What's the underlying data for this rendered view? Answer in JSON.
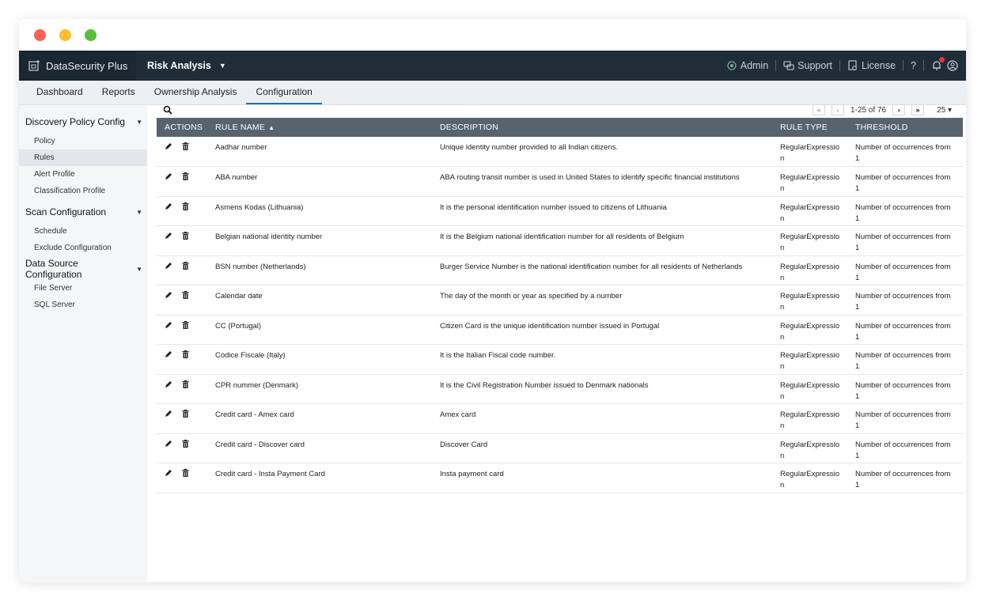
{
  "app": {
    "brand": "DataSecurity Plus",
    "module": "Risk Analysis",
    "header_links": [
      {
        "label": "Admin",
        "icon": "admin-icon"
      },
      {
        "label": "Support",
        "icon": "support-icon"
      },
      {
        "label": "License",
        "icon": "license-icon"
      }
    ],
    "help_symbol": "?"
  },
  "tabs": [
    "Dashboard",
    "Reports",
    "Ownership Analysis",
    "Configuration"
  ],
  "active_tab": "Configuration",
  "sidebar": {
    "groups": [
      {
        "label": "Discovery Policy Config",
        "items": [
          "Policy",
          "Rules",
          "Alert Profile",
          "Classification Profile"
        ]
      },
      {
        "label": "Scan Configuration",
        "items": [
          "Schedule",
          "Exclude Configuration"
        ]
      },
      {
        "label": "Data Source Configuration",
        "items": [
          "File Server",
          "SQL Server"
        ]
      }
    ],
    "active_item": "Rules"
  },
  "pager": {
    "range": "1-25 of 76",
    "first": "«",
    "prev": "‹",
    "next": "›",
    "last": "»",
    "per_page": "25"
  },
  "table": {
    "columns": [
      "ACTIONS",
      "RULE NAME",
      "DESCRIPTION",
      "RULE TYPE",
      "THRESHOLD"
    ],
    "sort_indicator": "▲",
    "rows": [
      {
        "name": "Aadhar number",
        "description": "Unique identity number provided to all Indian citizens.",
        "type": "RegularExpression",
        "threshold": "Number of occurrences from 1"
      },
      {
        "name": "ABA number",
        "description": "ABA routing transit number is used in United States to identify specific financial institutions",
        "type": "RegularExpression",
        "threshold": "Number of occurrences from 1"
      },
      {
        "name": "Asmens Kodas (Lithuania)",
        "description": "It is the personal identification number issued to citizens of Lithuania",
        "type": "RegularExpression",
        "threshold": "Number of occurrences from 1"
      },
      {
        "name": "Belgian national identity number",
        "description": "It is the Belgium national identification number for all residents of Belgium",
        "type": "RegularExpression",
        "threshold": "Number of occurrences from 1"
      },
      {
        "name": "BSN number (Netherlands)",
        "description": "Burger Service Number is the national identification number for all residents of Netherlands",
        "type": "RegularExpression",
        "threshold": "Number of occurrences from 1"
      },
      {
        "name": "Calendar date",
        "description": "The day of the month or year as specified by a number",
        "type": "RegularExpression",
        "threshold": "Number of occurrences from 1"
      },
      {
        "name": "CC (Portugal)",
        "description": "Citizen Card is the unique identification number issued in Portugal",
        "type": "RegularExpression",
        "threshold": "Number of occurrences from 1"
      },
      {
        "name": "Codice Fiscale (Italy)",
        "description": "It is the Italian Fiscal code number.",
        "type": "RegularExpression",
        "threshold": "Number of occurrences from 1"
      },
      {
        "name": "CPR nummer (Denmark)",
        "description": "It is the Civil Registration Number issued to Denmark nationals",
        "type": "RegularExpression",
        "threshold": "Number of occurrences from 1"
      },
      {
        "name": "Credit card - Amex card",
        "description": "Amex card",
        "type": "RegularExpression",
        "threshold": "Number of occurrences from 1"
      },
      {
        "name": "Credit card - Discover card",
        "description": "Discover Card",
        "type": "RegularExpression",
        "threshold": "Number of occurrences from 1"
      },
      {
        "name": "Credit card - Insta Payment Card",
        "description": "Insta payment card",
        "type": "RegularExpression",
        "threshold": "Number of occurrences from 1"
      }
    ]
  },
  "colors": {
    "appbar": "#1f2d38",
    "table_header": "#58636d",
    "active_tab_underline": "#1a6fb5",
    "notification_badge": "#e53935"
  }
}
